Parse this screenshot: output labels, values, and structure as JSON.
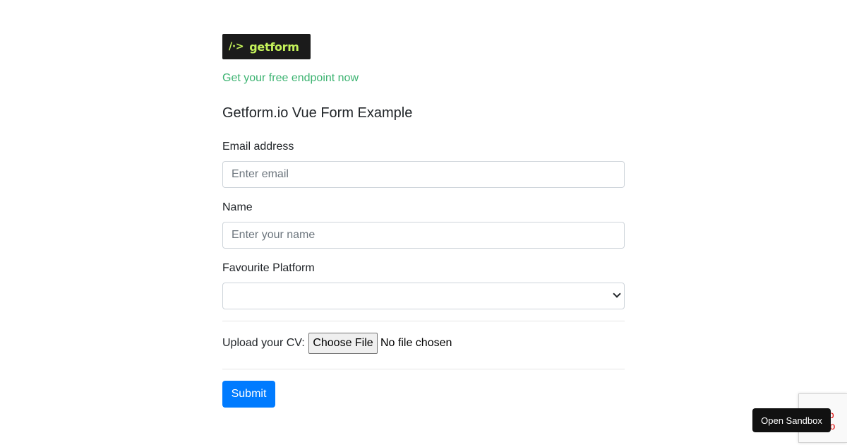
{
  "logo": {
    "mark": "/·>",
    "text": "getform"
  },
  "endpoint_link": "Get your free endpoint now",
  "form_title": "Getform.io Vue Form Example",
  "fields": {
    "email": {
      "label": "Email address",
      "placeholder": "Enter email",
      "value": ""
    },
    "name": {
      "label": "Name",
      "placeholder": "Enter your name",
      "value": ""
    },
    "platform": {
      "label": "Favourite Platform",
      "selected": ""
    }
  },
  "upload": {
    "label": "Upload your CV:",
    "button": "Choose File",
    "status": "No file chosen"
  },
  "submit_label": "Submit",
  "recaptcha": {
    "error_text": "R fo\nd do"
  },
  "sandbox_button": "Open Sandbox",
  "colors": {
    "link": "#3cb371",
    "primary": "#007bff",
    "logo_bg": "#1b1b1b",
    "logo_fg": "#c4f25a"
  }
}
